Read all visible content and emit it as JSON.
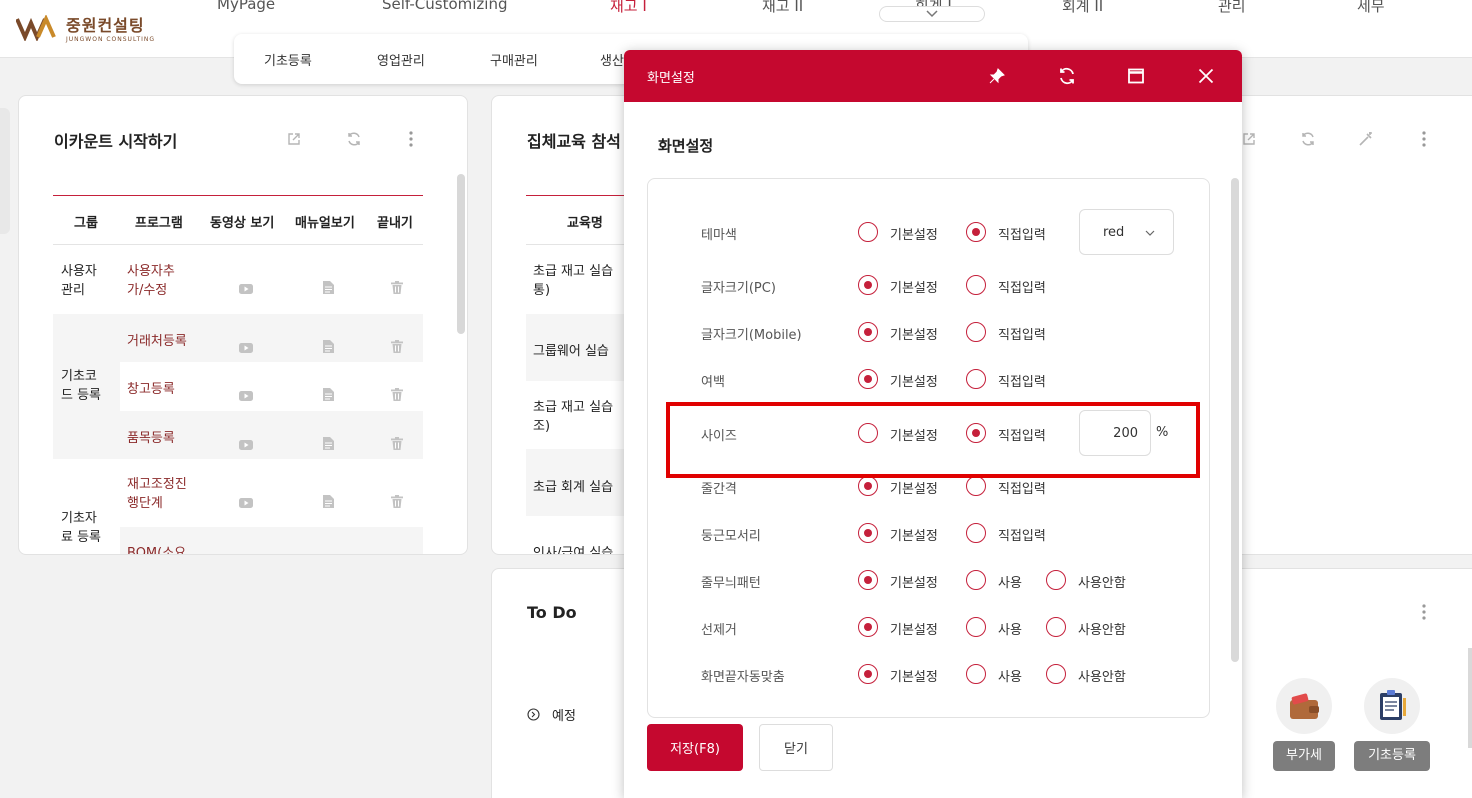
{
  "brand": {
    "name_kr": "중원컨설팅",
    "name_en": "JUNGWON CONSULTING"
  },
  "top_nav": [
    "MyPage",
    "Self-Customizing",
    "재고 I",
    "재고 II",
    "회계 I",
    "회계 II",
    "관리",
    "세무"
  ],
  "sub_nav": [
    "기초등록",
    "영업관리",
    "구매관리",
    "생산"
  ],
  "start_card": {
    "title": "이카운트 시작하기",
    "columns": [
      "그룹",
      "프로그램",
      "동영상 보기",
      "매뉴얼보기",
      "끝내기"
    ],
    "groups": [
      {
        "name": "사용자관리",
        "lines": [
          "사용자",
          "관리"
        ],
        "items": [
          [
            "사용자추",
            "가/수정"
          ]
        ]
      },
      {
        "name": "기초코드 등록",
        "lines": [
          "기초코",
          "드 등록"
        ],
        "items": [
          [
            "거래처등록"
          ],
          [
            "창고등록"
          ],
          [
            "품목등록"
          ]
        ]
      },
      {
        "name": "기초자료 등록",
        "lines": [
          "기초자",
          "료 등록"
        ],
        "items": [
          [
            "재고조정진",
            "행단계"
          ],
          [
            "BOM(소요"
          ]
        ]
      }
    ]
  },
  "edu_card": {
    "title": "집체교육 참석",
    "column": "교육명",
    "rows": [
      [
        "초급 재고 실습",
        "통)"
      ],
      [
        "그룹웨어 실습"
      ],
      [
        "초급 재고 실습",
        "조)"
      ],
      [
        "초급 회계 실습"
      ],
      [
        "인사/급여 실습"
      ]
    ]
  },
  "todo_card": {
    "title": "To Do",
    "item": "예정"
  },
  "quick_links": [
    {
      "label": "부가세",
      "icon": "wallet-icon"
    },
    {
      "label": "기초등록",
      "icon": "clipboard-icon"
    }
  ],
  "modal": {
    "title": "화면설정",
    "subtitle": "화면설정",
    "rows": [
      {
        "label": "테마색",
        "options": [
          "기본설정",
          "직접입력"
        ],
        "selected": 1,
        "select_value": "red"
      },
      {
        "label": "글자크기(PC)",
        "options": [
          "기본설정",
          "직접입력"
        ],
        "selected": 0
      },
      {
        "label": "글자크기(Mobile)",
        "options": [
          "기본설정",
          "직접입력"
        ],
        "selected": 0
      },
      {
        "label": "여백",
        "options": [
          "기본설정",
          "직접입력"
        ],
        "selected": 0
      },
      {
        "label": "사이즈",
        "options": [
          "기본설정",
          "직접입력"
        ],
        "selected": 1,
        "input_value": "200",
        "unit": "%"
      },
      {
        "label": "줄간격",
        "options": [
          "기본설정",
          "직접입력"
        ],
        "selected": 0
      },
      {
        "label": "둥근모서리",
        "options": [
          "기본설정",
          "직접입력"
        ],
        "selected": 0
      },
      {
        "label": "줄무늬패턴",
        "options": [
          "기본설정",
          "사용",
          "사용안함"
        ],
        "selected": 0
      },
      {
        "label": "선제거",
        "options": [
          "기본설정",
          "사용",
          "사용안함"
        ],
        "selected": 0
      },
      {
        "label": "화면끝자동맞춤",
        "options": [
          "기본설정",
          "사용",
          "사용안함"
        ],
        "selected": 0
      }
    ],
    "save_label": "저장(F8)",
    "close_label": "닫기"
  },
  "colors": {
    "accent": "#c5082f",
    "highlight": "#e00000"
  }
}
